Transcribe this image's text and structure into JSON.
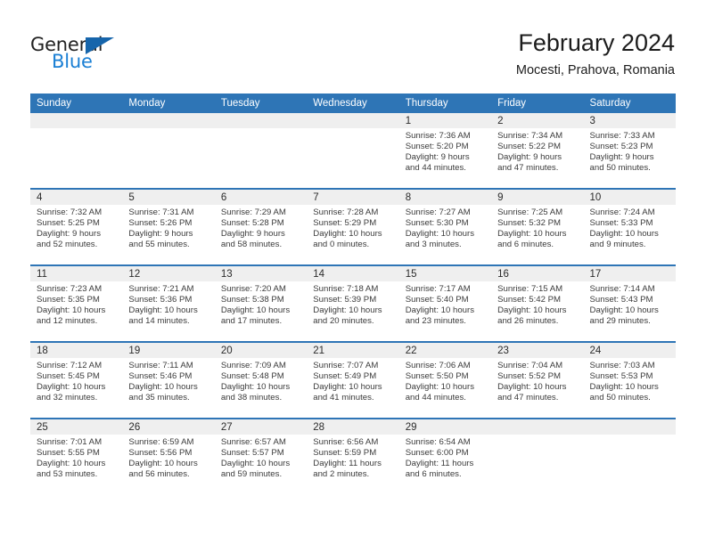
{
  "logo": {
    "word_one": "General",
    "word_two": "Blue",
    "icon": "triangle-icon",
    "color_dark": "#1665ab",
    "color_light": "#1a7fd4"
  },
  "header": {
    "title": "February 2024",
    "subtitle": "Mocesti, Prahova, Romania"
  },
  "theme": {
    "header_blue": "#2e75b6",
    "daynum_gray": "#efefef",
    "text": "#3b3b3b"
  },
  "weekdays": [
    "Sunday",
    "Monday",
    "Tuesday",
    "Wednesday",
    "Thursday",
    "Friday",
    "Saturday"
  ],
  "labels": {
    "sunrise_prefix": "Sunrise:",
    "sunset_prefix": "Sunset:",
    "daylight_prefix": "Daylight:"
  },
  "weeks": [
    [
      {
        "day": "",
        "empty": true,
        "l1": "",
        "l2": "",
        "l3": "",
        "l4": ""
      },
      {
        "day": "",
        "empty": true,
        "l1": "",
        "l2": "",
        "l3": "",
        "l4": ""
      },
      {
        "day": "",
        "empty": true,
        "l1": "",
        "l2": "",
        "l3": "",
        "l4": ""
      },
      {
        "day": "",
        "empty": true,
        "l1": "",
        "l2": "",
        "l3": "",
        "l4": ""
      },
      {
        "day": "1",
        "empty": false,
        "l1": "Sunrise: 7:36 AM",
        "l2": "Sunset: 5:20 PM",
        "l3": "Daylight: 9 hours",
        "l4": "and 44 minutes."
      },
      {
        "day": "2",
        "empty": false,
        "l1": "Sunrise: 7:34 AM",
        "l2": "Sunset: 5:22 PM",
        "l3": "Daylight: 9 hours",
        "l4": "and 47 minutes."
      },
      {
        "day": "3",
        "empty": false,
        "l1": "Sunrise: 7:33 AM",
        "l2": "Sunset: 5:23 PM",
        "l3": "Daylight: 9 hours",
        "l4": "and 50 minutes."
      }
    ],
    [
      {
        "day": "4",
        "empty": false,
        "l1": "Sunrise: 7:32 AM",
        "l2": "Sunset: 5:25 PM",
        "l3": "Daylight: 9 hours",
        "l4": "and 52 minutes."
      },
      {
        "day": "5",
        "empty": false,
        "l1": "Sunrise: 7:31 AM",
        "l2": "Sunset: 5:26 PM",
        "l3": "Daylight: 9 hours",
        "l4": "and 55 minutes."
      },
      {
        "day": "6",
        "empty": false,
        "l1": "Sunrise: 7:29 AM",
        "l2": "Sunset: 5:28 PM",
        "l3": "Daylight: 9 hours",
        "l4": "and 58 minutes."
      },
      {
        "day": "7",
        "empty": false,
        "l1": "Sunrise: 7:28 AM",
        "l2": "Sunset: 5:29 PM",
        "l3": "Daylight: 10 hours",
        "l4": "and 0 minutes."
      },
      {
        "day": "8",
        "empty": false,
        "l1": "Sunrise: 7:27 AM",
        "l2": "Sunset: 5:30 PM",
        "l3": "Daylight: 10 hours",
        "l4": "and 3 minutes."
      },
      {
        "day": "9",
        "empty": false,
        "l1": "Sunrise: 7:25 AM",
        "l2": "Sunset: 5:32 PM",
        "l3": "Daylight: 10 hours",
        "l4": "and 6 minutes."
      },
      {
        "day": "10",
        "empty": false,
        "l1": "Sunrise: 7:24 AM",
        "l2": "Sunset: 5:33 PM",
        "l3": "Daylight: 10 hours",
        "l4": "and 9 minutes."
      }
    ],
    [
      {
        "day": "11",
        "empty": false,
        "l1": "Sunrise: 7:23 AM",
        "l2": "Sunset: 5:35 PM",
        "l3": "Daylight: 10 hours",
        "l4": "and 12 minutes."
      },
      {
        "day": "12",
        "empty": false,
        "l1": "Sunrise: 7:21 AM",
        "l2": "Sunset: 5:36 PM",
        "l3": "Daylight: 10 hours",
        "l4": "and 14 minutes."
      },
      {
        "day": "13",
        "empty": false,
        "l1": "Sunrise: 7:20 AM",
        "l2": "Sunset: 5:38 PM",
        "l3": "Daylight: 10 hours",
        "l4": "and 17 minutes."
      },
      {
        "day": "14",
        "empty": false,
        "l1": "Sunrise: 7:18 AM",
        "l2": "Sunset: 5:39 PM",
        "l3": "Daylight: 10 hours",
        "l4": "and 20 minutes."
      },
      {
        "day": "15",
        "empty": false,
        "l1": "Sunrise: 7:17 AM",
        "l2": "Sunset: 5:40 PM",
        "l3": "Daylight: 10 hours",
        "l4": "and 23 minutes."
      },
      {
        "day": "16",
        "empty": false,
        "l1": "Sunrise: 7:15 AM",
        "l2": "Sunset: 5:42 PM",
        "l3": "Daylight: 10 hours",
        "l4": "and 26 minutes."
      },
      {
        "day": "17",
        "empty": false,
        "l1": "Sunrise: 7:14 AM",
        "l2": "Sunset: 5:43 PM",
        "l3": "Daylight: 10 hours",
        "l4": "and 29 minutes."
      }
    ],
    [
      {
        "day": "18",
        "empty": false,
        "l1": "Sunrise: 7:12 AM",
        "l2": "Sunset: 5:45 PM",
        "l3": "Daylight: 10 hours",
        "l4": "and 32 minutes."
      },
      {
        "day": "19",
        "empty": false,
        "l1": "Sunrise: 7:11 AM",
        "l2": "Sunset: 5:46 PM",
        "l3": "Daylight: 10 hours",
        "l4": "and 35 minutes."
      },
      {
        "day": "20",
        "empty": false,
        "l1": "Sunrise: 7:09 AM",
        "l2": "Sunset: 5:48 PM",
        "l3": "Daylight: 10 hours",
        "l4": "and 38 minutes."
      },
      {
        "day": "21",
        "empty": false,
        "l1": "Sunrise: 7:07 AM",
        "l2": "Sunset: 5:49 PM",
        "l3": "Daylight: 10 hours",
        "l4": "and 41 minutes."
      },
      {
        "day": "22",
        "empty": false,
        "l1": "Sunrise: 7:06 AM",
        "l2": "Sunset: 5:50 PM",
        "l3": "Daylight: 10 hours",
        "l4": "and 44 minutes."
      },
      {
        "day": "23",
        "empty": false,
        "l1": "Sunrise: 7:04 AM",
        "l2": "Sunset: 5:52 PM",
        "l3": "Daylight: 10 hours",
        "l4": "and 47 minutes."
      },
      {
        "day": "24",
        "empty": false,
        "l1": "Sunrise: 7:03 AM",
        "l2": "Sunset: 5:53 PM",
        "l3": "Daylight: 10 hours",
        "l4": "and 50 minutes."
      }
    ],
    [
      {
        "day": "25",
        "empty": false,
        "l1": "Sunrise: 7:01 AM",
        "l2": "Sunset: 5:55 PM",
        "l3": "Daylight: 10 hours",
        "l4": "and 53 minutes."
      },
      {
        "day": "26",
        "empty": false,
        "l1": "Sunrise: 6:59 AM",
        "l2": "Sunset: 5:56 PM",
        "l3": "Daylight: 10 hours",
        "l4": "and 56 minutes."
      },
      {
        "day": "27",
        "empty": false,
        "l1": "Sunrise: 6:57 AM",
        "l2": "Sunset: 5:57 PM",
        "l3": "Daylight: 10 hours",
        "l4": "and 59 minutes."
      },
      {
        "day": "28",
        "empty": false,
        "l1": "Sunrise: 6:56 AM",
        "l2": "Sunset: 5:59 PM",
        "l3": "Daylight: 11 hours",
        "l4": "and 2 minutes."
      },
      {
        "day": "29",
        "empty": false,
        "l1": "Sunrise: 6:54 AM",
        "l2": "Sunset: 6:00 PM",
        "l3": "Daylight: 11 hours",
        "l4": "and 6 minutes."
      },
      {
        "day": "",
        "empty": true,
        "l1": "",
        "l2": "",
        "l3": "",
        "l4": ""
      },
      {
        "day": "",
        "empty": true,
        "l1": "",
        "l2": "",
        "l3": "",
        "l4": ""
      }
    ]
  ]
}
